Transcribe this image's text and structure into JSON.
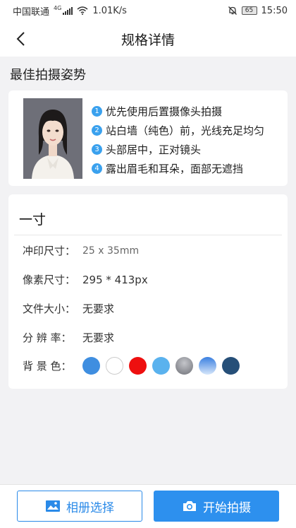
{
  "status_bar": {
    "carrier": "中国联通",
    "network": "4G",
    "speed": "1.01K/s",
    "battery": "65",
    "time": "15:50"
  },
  "nav": {
    "title": "规格详情",
    "back_icon": "chevron-left-icon"
  },
  "tips_section": {
    "title": "最佳拍摄姿势",
    "tips": [
      {
        "num": "1",
        "text": "优先使用后置摄像头拍摄"
      },
      {
        "num": "2",
        "text": "站白墙（纯色）前，光线充足均匀"
      },
      {
        "num": "3",
        "text": "头部居中，正对镜头"
      },
      {
        "num": "4",
        "text": "露出眉毛和耳朵，面部无遮挡"
      }
    ]
  },
  "spec": {
    "title": "一寸",
    "rows": [
      {
        "label": "冲印尺寸：",
        "value": "25 x 35mm"
      },
      {
        "label": "像素尺寸：",
        "value": "295 * 413px"
      },
      {
        "label": "文件大小：",
        "value": "无要求"
      },
      {
        "label": "分 辨 率：",
        "value": "无要求"
      }
    ],
    "bg_label": "背 景 色：",
    "bg_colors": [
      {
        "name": "blue",
        "color": "#3f8ee0"
      },
      {
        "name": "white",
        "color": "#ffffff"
      },
      {
        "name": "red",
        "color": "#ee0f0f"
      },
      {
        "name": "light-blue",
        "color": "#5ab2ee"
      },
      {
        "name": "gray-gradient",
        "color": "#8a8c92"
      },
      {
        "name": "blue-gradient",
        "color": "#5f9de6"
      },
      {
        "name": "dark-blue",
        "color": "#264f78"
      }
    ]
  },
  "bottom": {
    "album_label": "相册选择",
    "shoot_label": "开始拍摄"
  },
  "colors": {
    "accent": "#2d90ee",
    "tip_badge": "#3aa1ee"
  }
}
